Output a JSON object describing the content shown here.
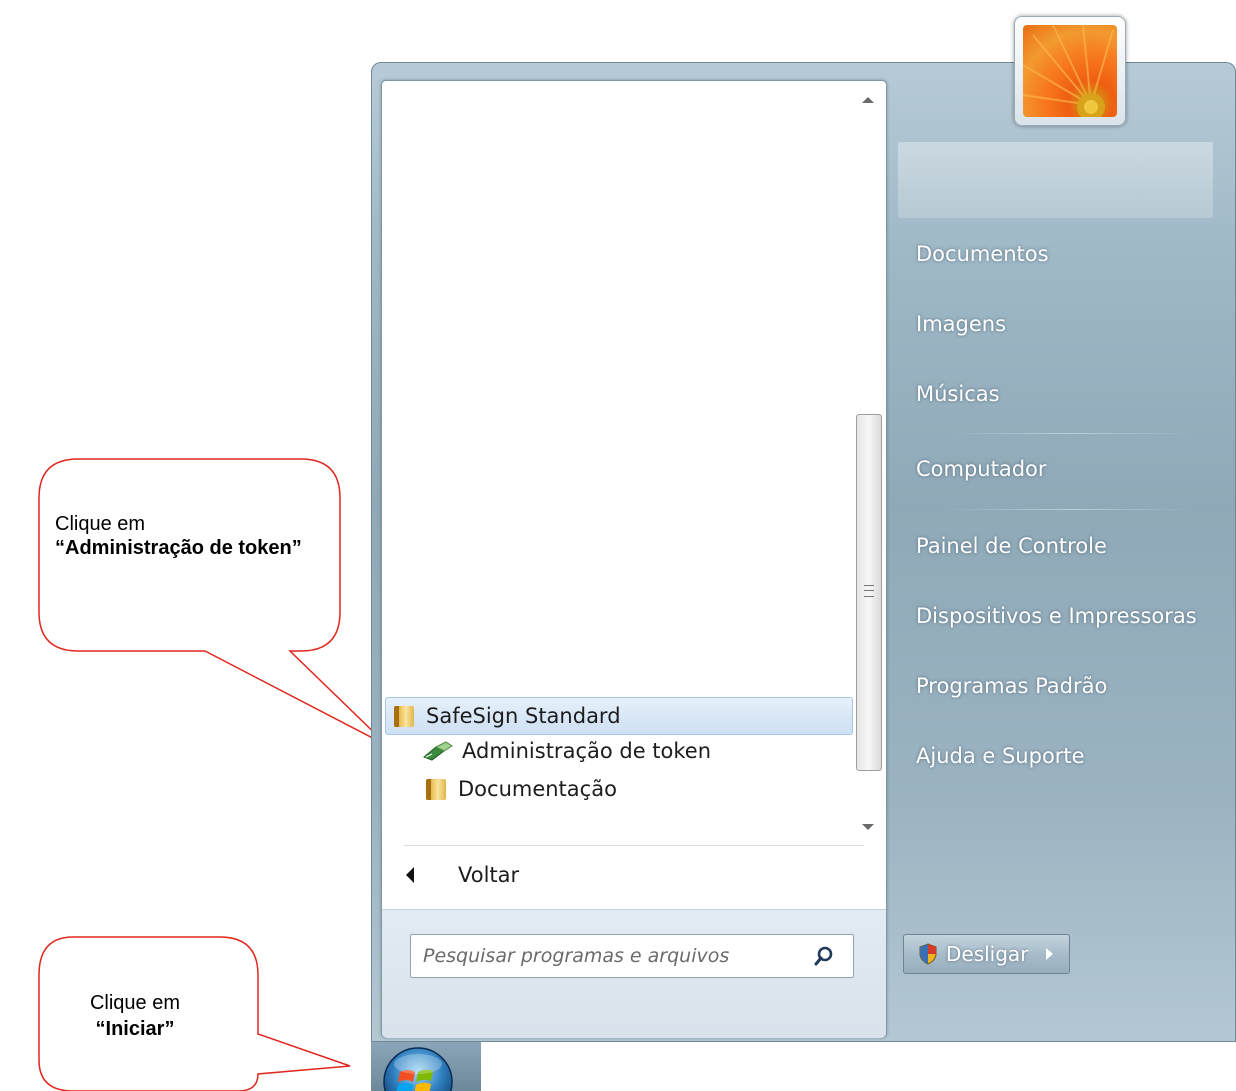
{
  "menu": {
    "programs": {
      "folder_open": "SafeSign Standard",
      "items": [
        {
          "label": "Administração de token",
          "icon": "token-tool-icon"
        },
        {
          "label": "Documentação",
          "icon": "folder-icon"
        }
      ]
    },
    "back_label": "Voltar",
    "search_placeholder": "Pesquisar programas e arquivos",
    "right_items": [
      "Documentos",
      "Imagens",
      "Músicas",
      "Computador",
      "Painel de Controle",
      "Dispositivos e Impressoras",
      "Programas Padrão",
      "Ajuda e Suporte"
    ],
    "shutdown_label": "Desligar"
  },
  "callouts": {
    "admin": {
      "line1": "Clique em",
      "line2": "“Administração de token”"
    },
    "start": {
      "line1": "Clique em",
      "line2": "“Iniciar”"
    }
  },
  "colors": {
    "callout_border": "#e0281e",
    "highlight_row": "#cde0f3",
    "menu_frame": "#9fb8c6"
  }
}
